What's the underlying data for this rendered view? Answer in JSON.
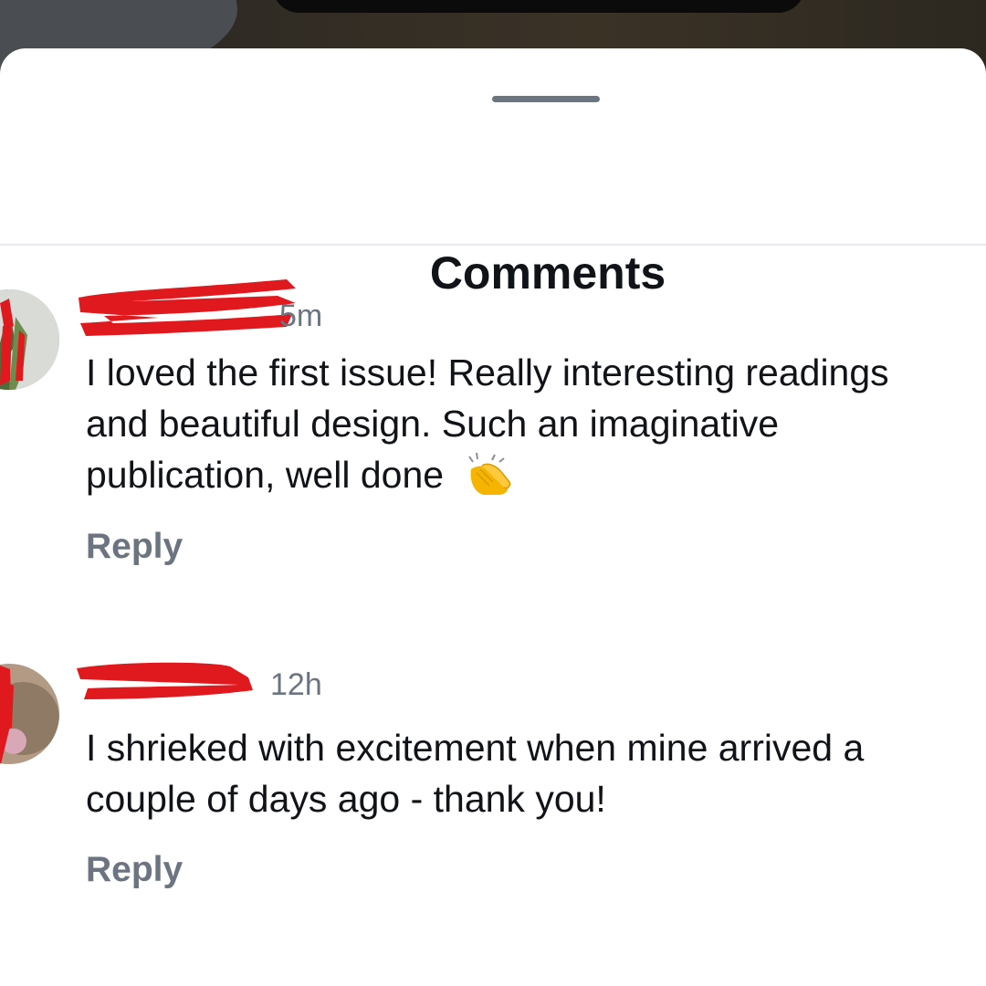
{
  "sheet": {
    "title": "Comments"
  },
  "comments": [
    {
      "author": "",
      "timestamp": "5m",
      "body": "I loved the first issue! Really interesting readings and beautiful design. Such an imaginative publication, well done",
      "emoji_icon": "clapping-hands-icon",
      "reply_label": "Reply"
    },
    {
      "author": "",
      "timestamp": "12h",
      "body": "I shrieked with excitement when mine arrived a couple of days ago - thank you!",
      "reply_label": "Reply"
    }
  ],
  "colors": {
    "text_primary": "#101418",
    "text_secondary": "#6b7480",
    "redaction": "#e0191e",
    "divider": "#e8eaed",
    "sheet_background": "#ffffff"
  }
}
